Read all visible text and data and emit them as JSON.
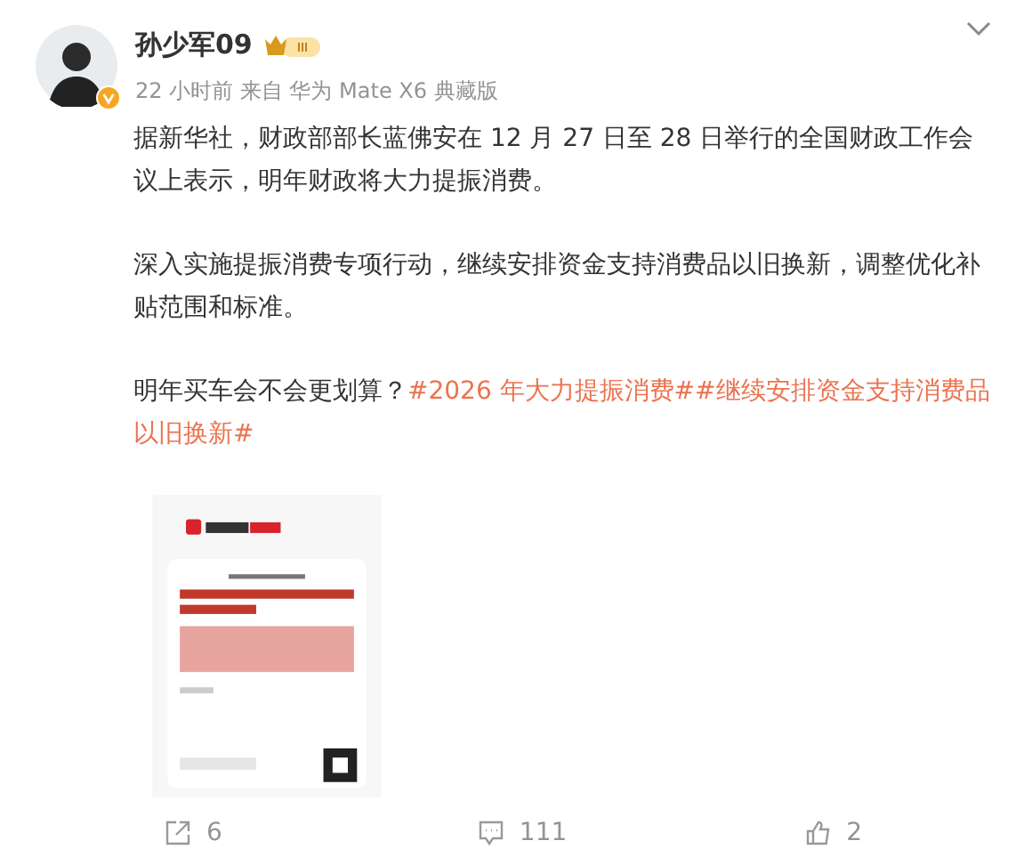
{
  "post": {
    "author": "孙少军09",
    "time": "22 小时前",
    "source": "来自 华为 Mate X6 典藏版",
    "paragraphs": [
      [
        {
          "kind": "text",
          "text": "据新华社，财政部部长蓝佛安在 12 月 27 日至 28 日举行的全国财政工作会议上表示，明年财政将大力提振消费。"
        }
      ],
      [
        {
          "kind": "text",
          "text": "深入实施提振消费专项行动，继续安排资金支持消费品以旧换新，调整优化补贴范围和标准。"
        }
      ],
      [
        {
          "kind": "text",
          "text": "明年买车会不会更划算？"
        },
        {
          "kind": "topic",
          "text": "#2026 年大力提振消费#"
        },
        {
          "kind": "topic",
          "text": "#继续安排资金支持消费品以旧换新#"
        }
      ]
    ],
    "actions": [
      {
        "kind": "share",
        "count": "6"
      },
      {
        "kind": "comment",
        "count": "111"
      },
      {
        "kind": "like",
        "count": "2"
      }
    ]
  }
}
